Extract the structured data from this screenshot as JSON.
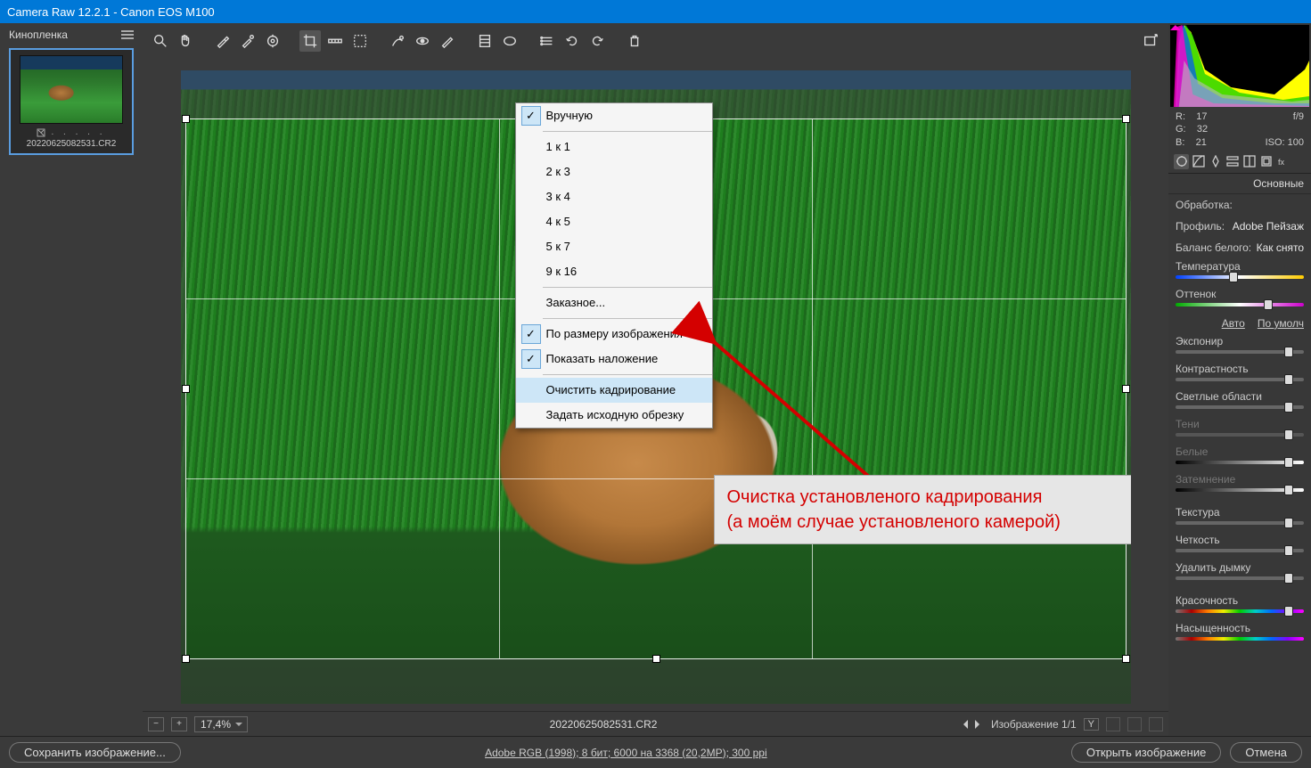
{
  "titlebar": "Camera Raw 12.2.1  -  Canon EOS M100",
  "filmstrip": {
    "header": "Кинопленка",
    "thumb_label": "20220625082531.CR2"
  },
  "context_menu": {
    "manual": "Вручную",
    "r1": "1 к 1",
    "r2": "2 к 3",
    "r3": "3 к 4",
    "r4": "4 к 5",
    "r5": "5 к 7",
    "r6": "9 к 16",
    "custom": "Заказное...",
    "fit": "По размеру изображения",
    "overlay": "Показать наложение",
    "clear": "Очистить кадрирование",
    "orig": "Задать исходную обрезку"
  },
  "annotation": {
    "line1": "Очистка установленого кадрирования",
    "line2": "(а моём случае установленого камерой)"
  },
  "status": {
    "zoom": "17,4%",
    "filename": "20220625082531.CR2",
    "counter": "Изображение 1/1",
    "y": "Y"
  },
  "readout": {
    "r": "R:",
    "r_v": "17",
    "g": "G:",
    "g_v": "32",
    "b": "B:",
    "b_v": "21",
    "f": "f/9",
    "iso": "ISO: 100"
  },
  "panel": {
    "title": "Основные",
    "treatment_lbl": "Обработка:",
    "profile_lbl": "Профиль:",
    "profile_val": "Adobe Пейзаж",
    "wb_lbl": "Баланс белого:",
    "wb_val": "Как снято",
    "temp": "Температура",
    "tint": "Оттенок",
    "auto": "Авто",
    "default": "По умолч",
    "exposure": "Экспонир",
    "contrast": "Контрастность",
    "highlights": "Светлые области",
    "shadows": "Тени",
    "whites": "Белые",
    "blacks": "Затемнение",
    "texture": "Текстура",
    "clarity": "Четкость",
    "dehaze": "Удалить дымку",
    "vibrance": "Красочность",
    "saturation": "Насыщенность"
  },
  "footer": {
    "save": "Сохранить изображение...",
    "meta": "Adobe RGB (1998); 8 бит; 6000 на 3368 (20,2МР); 300 ppi",
    "open": "Открыть изображение",
    "cancel": "Отмена"
  }
}
